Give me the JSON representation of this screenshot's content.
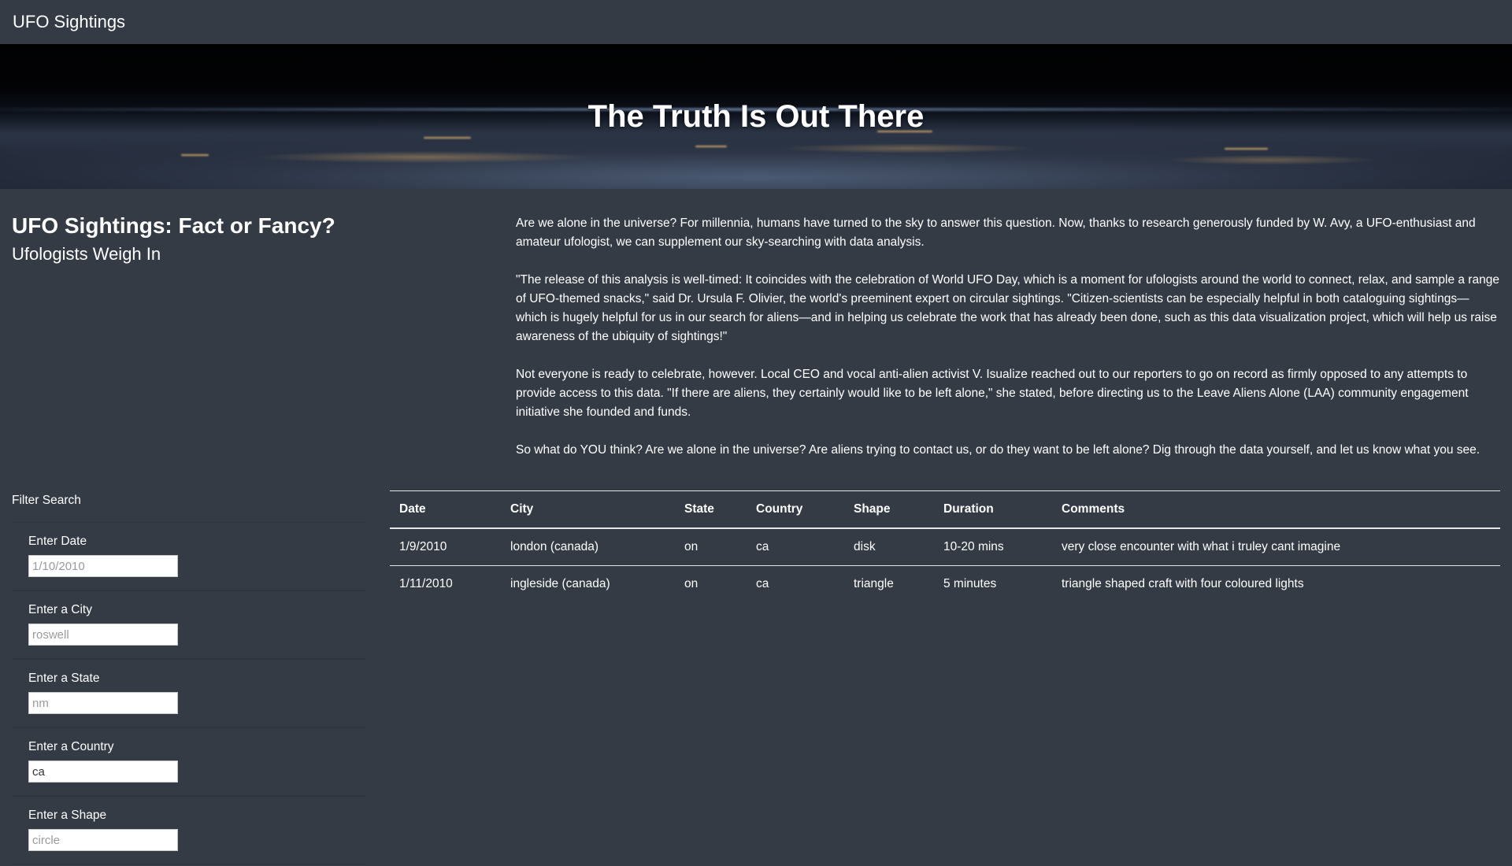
{
  "navbar": {
    "brand": "UFO Sightings"
  },
  "hero": {
    "title": "The Truth Is Out There"
  },
  "intro": {
    "heading": "UFO Sightings: Fact or Fancy?",
    "subheading": "Ufologists Weigh In",
    "paragraphs": [
      "Are we alone in the universe? For millennia, humans have turned to the sky to answer this question. Now, thanks to research generously funded by W. Avy, a UFO-enthusiast and amateur ufologist, we can supplement our sky-searching with data analysis.",
      "\"The release of this analysis is well-timed: It coincides with the celebration of World UFO Day, which is a moment for ufologists around the world to connect, relax, and sample a range of UFO-themed snacks,\" said Dr. Ursula F. Olivier, the world's preeminent expert on circular sightings. \"Citizen-scientists can be especially helpful in both cataloguing sightings—which is hugely helpful for us in our search for aliens—and in helping us celebrate the work that has already been done, such as this data visualization project, which will help us raise awareness of the ubiquity of sightings!\"",
      "Not everyone is ready to celebrate, however. Local CEO and vocal anti-alien activist V. Isualize reached out to our reporters to go on record as firmly opposed to any attempts to provide access to this data. \"If there are aliens, they certainly would like to be left alone,\" she stated, before directing us to the Leave Aliens Alone (LAA) community engagement initiative she founded and funds.",
      "So what do YOU think? Are we alone in the universe? Are aliens trying to contact us, or do they want to be left alone? Dig through the data yourself, and let us know what you see."
    ]
  },
  "filters": {
    "title": "Filter Search",
    "items": [
      {
        "label": "Enter Date",
        "placeholder": "1/10/2010",
        "value": ""
      },
      {
        "label": "Enter a City",
        "placeholder": "roswell",
        "value": ""
      },
      {
        "label": "Enter a State",
        "placeholder": "nm",
        "value": ""
      },
      {
        "label": "Enter a Country",
        "placeholder": "",
        "value": "ca"
      },
      {
        "label": "Enter a Shape",
        "placeholder": "circle",
        "value": ""
      }
    ]
  },
  "table": {
    "headers": [
      "Date",
      "City",
      "State",
      "Country",
      "Shape",
      "Duration",
      "Comments"
    ],
    "rows": [
      [
        "1/9/2010",
        "london (canada)",
        "on",
        "ca",
        "disk",
        "10-20 mins",
        "very close encounter with what i truley cant imagine"
      ],
      [
        "1/11/2010",
        "ingleside (canada)",
        "on",
        "ca",
        "triangle",
        "5 minutes",
        "triangle shaped craft with four coloured lights"
      ]
    ]
  }
}
